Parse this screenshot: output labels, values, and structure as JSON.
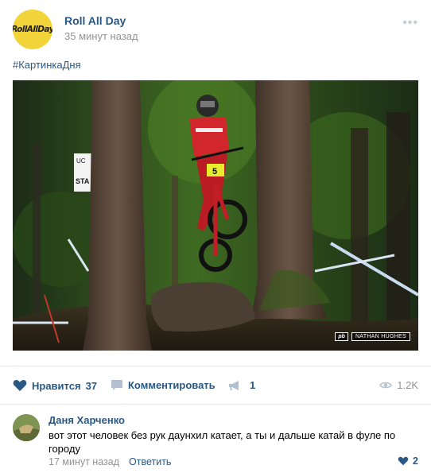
{
  "post": {
    "author": "Roll All Day",
    "avatar_text": "RollAllDay",
    "time": "35 минут назад",
    "hashtag": "#КартинкаДня",
    "photo": {
      "watermark_logo": "pb",
      "watermark_credit": "NATHAN HUGHES",
      "sign_text": "STA",
      "sign_text_top": "UC",
      "rider_number": "5"
    }
  },
  "actions": {
    "like_label": "Нравится",
    "like_count": "37",
    "comment_label": "Комментировать",
    "share_count": "1",
    "views": "1.2K"
  },
  "comment": {
    "author": "Даня Харченко",
    "text": "вот этот человек без рук даунхил катает, а ты и дальше катай в фуле по городу",
    "time": "17 минут назад",
    "reply_label": "Ответить",
    "like_count": "2"
  },
  "colors": {
    "link": "#2a5885",
    "meta": "#939393",
    "divider": "#e7e8ec",
    "avatar_bg": "#f2d43a"
  }
}
